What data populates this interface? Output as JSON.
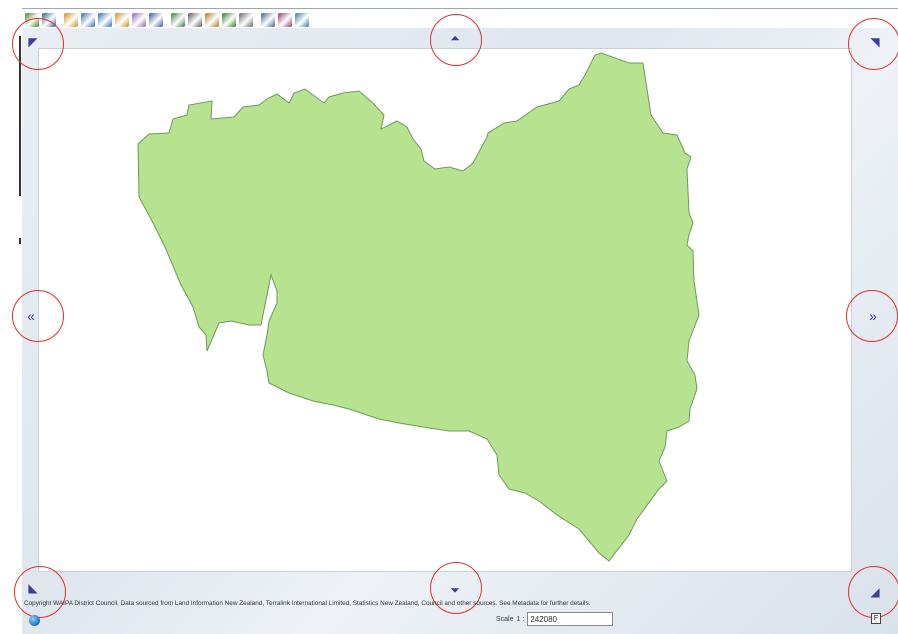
{
  "toolbar": {
    "icons": [
      {
        "name": "edit-pencil-icon",
        "color": "#4f7f1f"
      },
      {
        "name": "select-tool-icon",
        "color": "#2a5f8f"
      },
      {
        "name": "zoom-in-icon",
        "color": "#d08a16"
      },
      {
        "name": "zoom-out-icon",
        "color": "#2e6db3"
      },
      {
        "name": "zoom-extent-icon",
        "color": "#2e6db3"
      },
      {
        "name": "pan-hand-icon",
        "color": "#c7901f"
      },
      {
        "name": "layers-icon",
        "color": "#8a63b5"
      },
      {
        "name": "grid-icon",
        "color": "#2d59a6"
      },
      {
        "name": "identify-icon",
        "color": "#3b7a3b"
      },
      {
        "name": "measure-icon",
        "color": "#5a5a5a"
      },
      {
        "name": "search-map-icon",
        "color": "#b07a1a"
      },
      {
        "name": "legend-icon",
        "color": "#2b7b2b"
      },
      {
        "name": "text-tool-icon",
        "color": "#666666"
      },
      {
        "name": "print-icon",
        "color": "#3f5f8f"
      },
      {
        "name": "eraser-icon",
        "color": "#8e3c6a"
      },
      {
        "name": "export-icon",
        "color": "#2f7f9f"
      }
    ]
  },
  "pan": {
    "nw": "◤",
    "n": "⏶",
    "ne": "◥",
    "w": "«",
    "e": "»",
    "sw": "◣",
    "s": "⏷",
    "se": "◢"
  },
  "map": {
    "fill_color": "#b7e28f",
    "stroke_color": "#6e9a5a",
    "background": "#ffffff"
  },
  "footer": {
    "copyright": "Copyright WAIPA District Council. Data sourced from Land Information New Zealand, Terralink International Limited, Statistics New Zealand, Council and other sources. See Metadata for further details.",
    "scale_label": "Scale",
    "scale_prefix": "1 :",
    "scale_value": "242080",
    "f_label": "F"
  },
  "highlight_color": "#e03030"
}
